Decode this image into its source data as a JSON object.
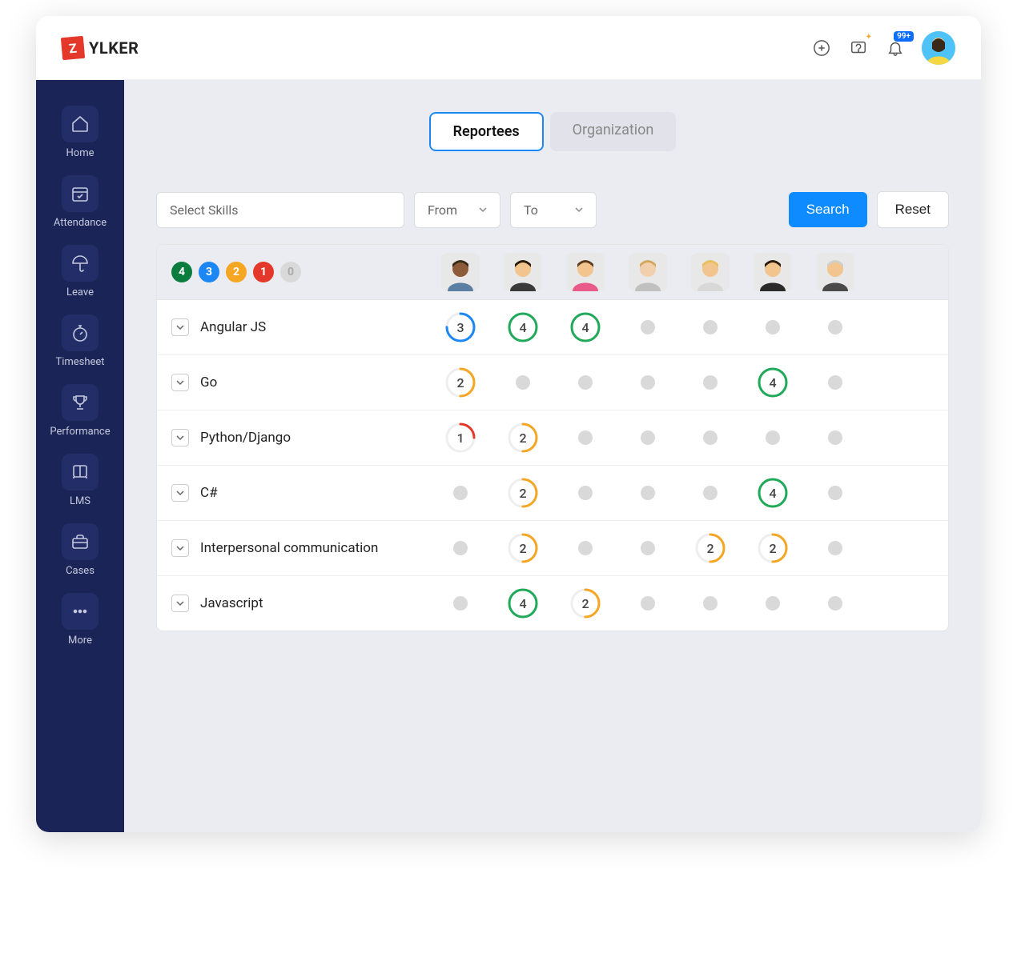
{
  "brand": {
    "badge_letter": "Z",
    "name": "YLKER"
  },
  "topbar": {
    "notification_badge": "99+"
  },
  "sidebar": {
    "items": [
      {
        "label": "Home"
      },
      {
        "label": "Attendance"
      },
      {
        "label": "Leave"
      },
      {
        "label": "Timesheet"
      },
      {
        "label": "Performance"
      },
      {
        "label": "LMS"
      },
      {
        "label": "Cases"
      },
      {
        "label": "More"
      }
    ]
  },
  "tabs": {
    "reportees": "Reportees",
    "organization": "Organization"
  },
  "filters": {
    "skills_placeholder": "Select Skills",
    "from_label": "From",
    "to_label": "To",
    "search_label": "Search",
    "reset_label": "Reset"
  },
  "legend": {
    "l4": "4",
    "l3": "3",
    "l2": "2",
    "l1": "1",
    "l0": "0"
  },
  "colors": {
    "level4": "#1faa59",
    "level3": "#1b87f5",
    "level2": "#f5a623",
    "level1": "#e4382b"
  },
  "people": [
    {
      "id": "p1"
    },
    {
      "id": "p2"
    },
    {
      "id": "p3"
    },
    {
      "id": "p4"
    },
    {
      "id": "p5"
    },
    {
      "id": "p6"
    },
    {
      "id": "p7"
    }
  ],
  "skills": [
    {
      "name": "Angular JS",
      "ratings": [
        3,
        4,
        4,
        null,
        null,
        null,
        null
      ]
    },
    {
      "name": "Go",
      "ratings": [
        2,
        null,
        null,
        null,
        null,
        4,
        null
      ]
    },
    {
      "name": "Python/Django",
      "ratings": [
        1,
        2,
        null,
        null,
        null,
        null,
        null
      ]
    },
    {
      "name": "C#",
      "ratings": [
        null,
        2,
        null,
        null,
        null,
        4,
        null
      ]
    },
    {
      "name": "Interpersonal communication",
      "ratings": [
        null,
        2,
        null,
        null,
        2,
        2,
        null
      ]
    },
    {
      "name": "Javascript",
      "ratings": [
        null,
        4,
        2,
        null,
        null,
        null,
        null
      ]
    }
  ]
}
